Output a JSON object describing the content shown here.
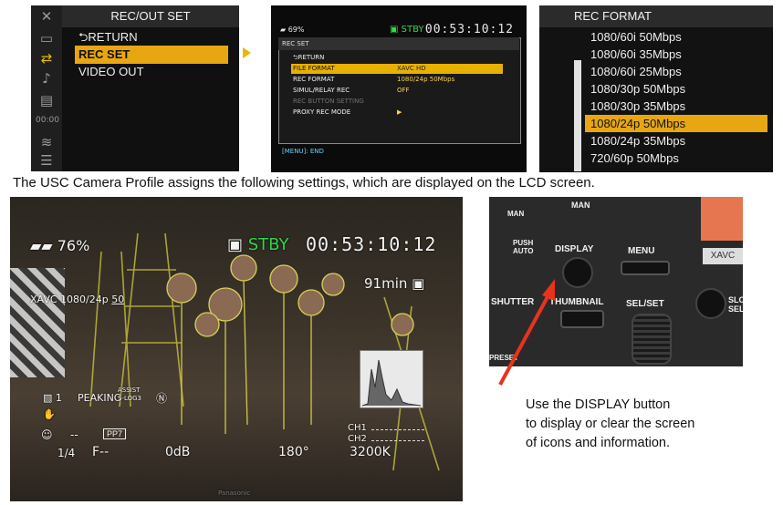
{
  "panel_rec_out_set": {
    "title": "REC/OUT SET",
    "items": [
      "RETURN",
      "REC SET",
      "VIDEO OUT"
    ],
    "selected_index": 1,
    "return_icon": "return-arrow-icon",
    "sidebar_icons": [
      "close-icon",
      "camera-media-icon",
      "swap-arrows-icon",
      "music-note-icon",
      "film-icon",
      "timecode-icon",
      "wifi-icon",
      "list-icon"
    ]
  },
  "panel_rec_set": {
    "battery": "69%",
    "status": "STBY",
    "timecode": "00:53:10:12",
    "header": "REC SET",
    "rows": [
      {
        "label": "RETURN",
        "value": ""
      },
      {
        "label": "FILE FORMAT",
        "value": "XAVC HD"
      },
      {
        "label": "REC FORMAT",
        "value": "1080/24p 50Mbps"
      },
      {
        "label": "SIMUL/RELAY REC",
        "value": "OFF"
      },
      {
        "label": "REC BUTTON SETTING",
        "value": ""
      },
      {
        "label": "PROXY REC MODE",
        "value": "▶"
      }
    ],
    "selected_index": 1,
    "footer": "[MENU]: END"
  },
  "panel_rec_format": {
    "title": "REC FORMAT",
    "options": [
      "1080/60i 50Mbps",
      "1080/60i 35Mbps",
      "1080/60i 25Mbps",
      "1080/30p 50Mbps",
      "1080/30p 35Mbps",
      "1080/24p 50Mbps",
      "1080/24p 35Mbps",
      "720/60p 50Mbps"
    ],
    "selected_index": 5
  },
  "caption": "The USC Camera Profile assigns the following settings, which are displayed on the LCD screen.",
  "lcd": {
    "battery": "76%",
    "status": "STBY",
    "timecode": "00:53:10:12",
    "remaining": "91min",
    "format": "XAVC 1080/24p",
    "bitrate": "50",
    "nd_num": "1",
    "peaking": "PEAKING",
    "assist_top": "ASSIST",
    "assist_bottom": "S-LOG3",
    "face": "--",
    "picture_profile": "PP7",
    "nd_filter": "1/4",
    "iris": "F--",
    "gain": "0dB",
    "shutter": "180°",
    "white_balance": "3200K",
    "ch1": "CH1",
    "ch2": "CH2",
    "brand": "Panasonic"
  },
  "camera": {
    "man": "MAN",
    "man2": "MAN",
    "push_auto": "PUSH AUTO",
    "display": "DISPLAY",
    "menu": "MENU",
    "xavc": "XAVC",
    "shutter": "SHUTTER",
    "thumbnail": "THUMBNAIL",
    "sel_set": "SEL/SET",
    "slot": "SLO SEL",
    "preset": "PRESET"
  },
  "note_lines": [
    "Use the DISPLAY button",
    "to display or clear the screen",
    "of icons and information."
  ],
  "colors": {
    "highlight": "#e7a612",
    "stby_green": "#2fd84a",
    "pointer_red": "#e8331c"
  }
}
